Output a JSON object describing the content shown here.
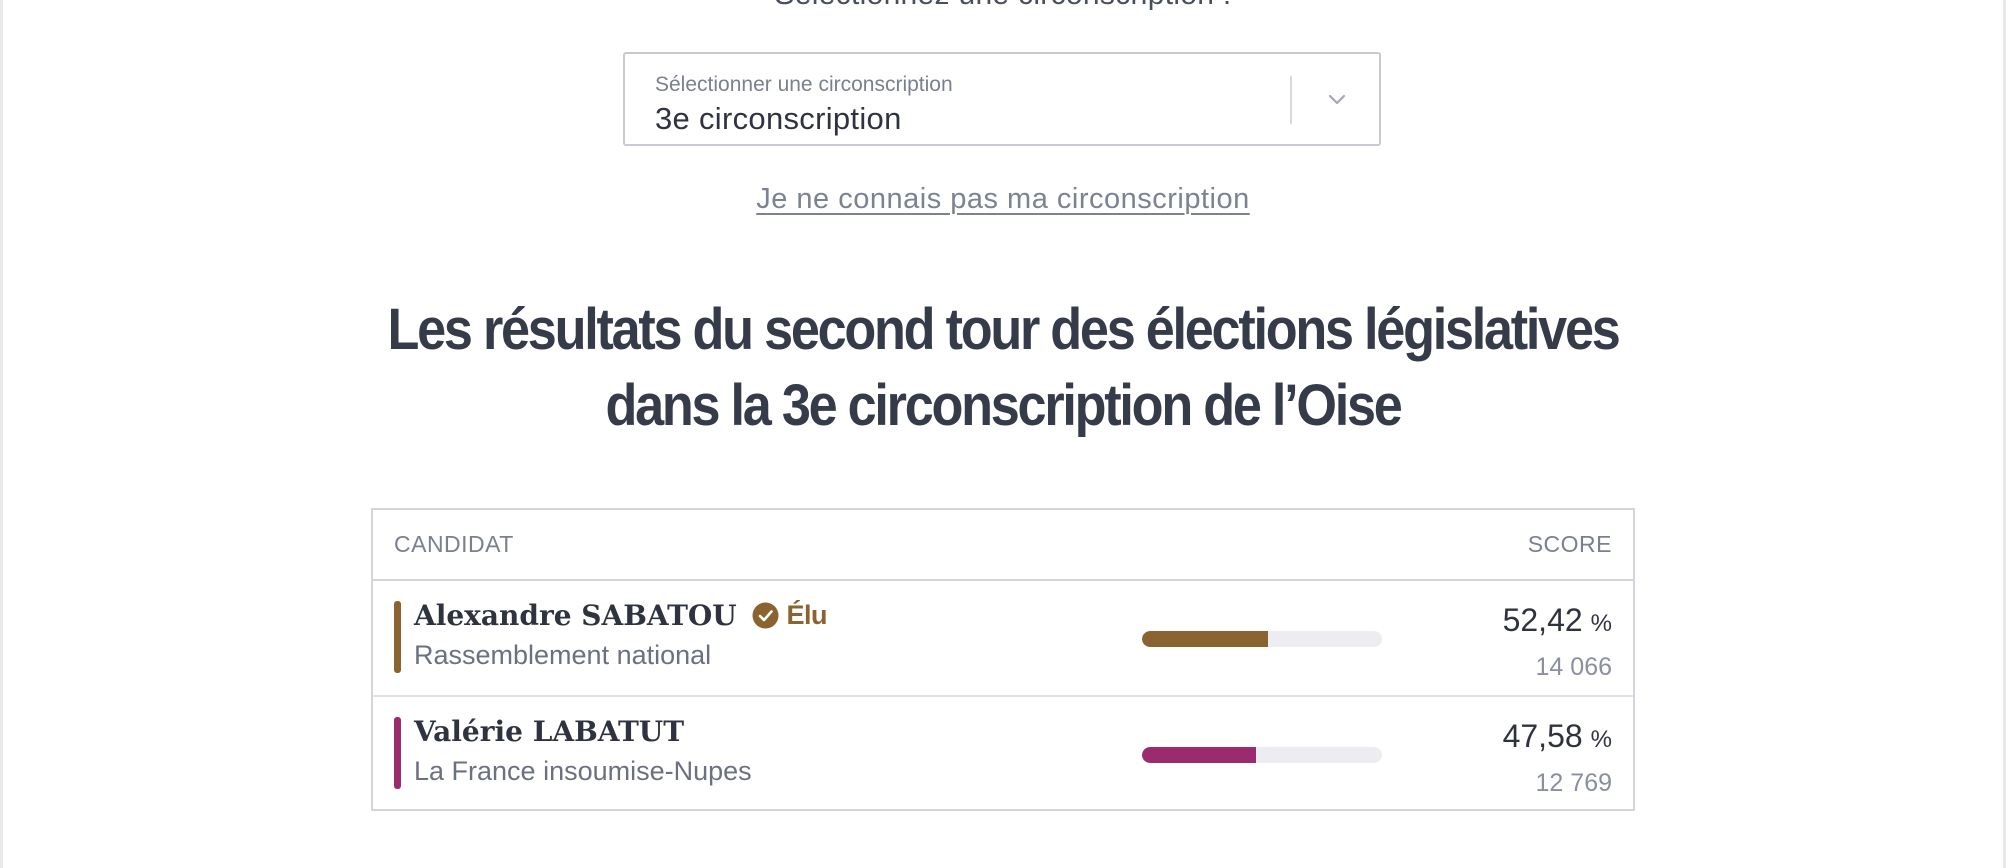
{
  "prompt": "Sélectionnez une circonscription :",
  "select": {
    "label": "Sélectionner une circonscription",
    "value": "3e circonscription"
  },
  "help_link": "Je ne connais pas ma circonscription",
  "title": {
    "line1": "Les résultats du second tour des élections législatives",
    "line2": "dans la 3e circonscription de l’Oise"
  },
  "table": {
    "col_candidat": "CANDIDAT",
    "col_score": "SCORE",
    "rows": [
      {
        "name": "Alexandre SABATOU",
        "elected_label": "Élu",
        "party": "Rassemblement national",
        "pct": "52,42",
        "pct_value": 52.42,
        "unit": "%",
        "votes": "14 066",
        "color": "#8b6330"
      },
      {
        "name": "Valérie LABATUT",
        "elected_label": "",
        "party": "La France insoumise-Nupes",
        "pct": "47,58",
        "pct_value": 47.58,
        "unit": "%",
        "votes": "12 769",
        "color": "#9b2a6f"
      }
    ]
  },
  "icons": {
    "select_chevron": "chevron-down-icon",
    "elected": "check-circle-icon"
  },
  "colors": {
    "text_dark": "#363b4a",
    "text_muted": "#7a8091",
    "border": "#d3d5db",
    "track": "#ececf1"
  }
}
